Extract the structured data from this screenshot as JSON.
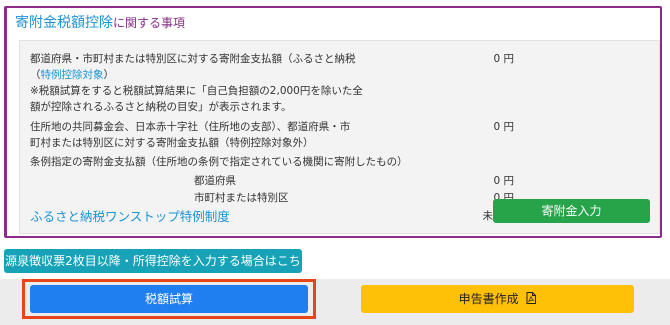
{
  "section": {
    "title_lead": "寄附金税額控除",
    "title_tail": "に関する事項"
  },
  "furusato": {
    "label_line1": "都道府県・市町村または特別区に対する寄附金支払額（ふるさと納税",
    "label_line2_prefix": "（",
    "link": "特例控除対象",
    "label_line2_suffix": "）",
    "amount": "0 円",
    "note_line1": "※税額試算をすると税額試算結果に「自己負担額の2,000円を除いた全",
    "note_line2": "額が控除されるふるさと納税の目安」が表示されます。"
  },
  "kyodo": {
    "label_line1": "住所地の共同募金会、日本赤十字社（住所地の支部）、都道府県・市",
    "label_line2": "町村または特別区に対する寄附金支払額（特例控除対象外）",
    "amount": "0 円"
  },
  "jorei": {
    "label": "条例指定の寄附金支払額（住所地の条例で指定されている機関に寄附したもの）",
    "prefecture_label": "都道府県",
    "prefecture_amount": "0 円",
    "municipality_label": "市町村または特別区",
    "municipality_amount": "0 円"
  },
  "onestop": {
    "link": "ふるさと納税ワンストップ特例制度",
    "status": "未適用",
    "button": "寄附金入力"
  },
  "gensen_button": "源泉徴収票2枚目以降・所得控除を入力する場合はこちら",
  "footer": {
    "calc_button": "税額試算",
    "form_button": "申告書作成"
  },
  "colors": {
    "panel_border": "#8b2c8b",
    "link": "#1a94d2",
    "green": "#27a34a",
    "teal": "#17a2b8",
    "blue": "#1f7ef0",
    "yellow": "#ffc107",
    "highlight": "#e8451a"
  },
  "icons": {
    "form_button_icon": "pdf-file-icon"
  }
}
